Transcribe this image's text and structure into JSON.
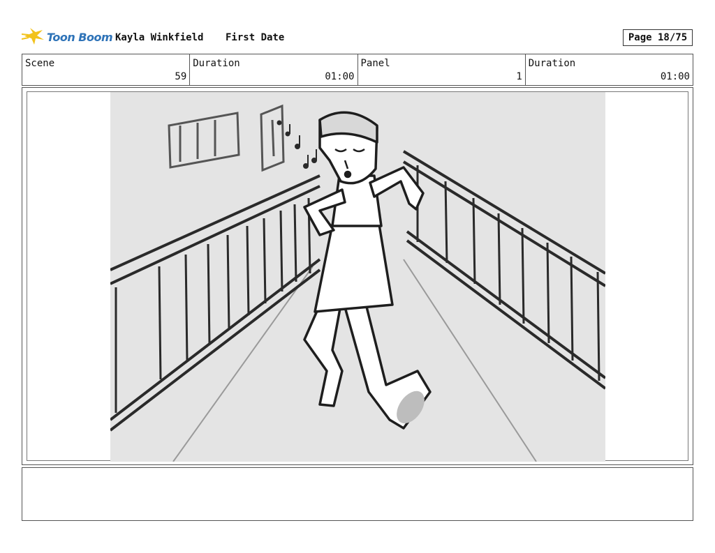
{
  "header": {
    "logo_text": "Toon Boom",
    "author": "Kayla Winkfield",
    "project": "First Date",
    "page": "Page 18/75"
  },
  "info": {
    "scene_label": "Scene",
    "scene_value": "59",
    "duration_label": "Duration",
    "duration_value": "01:00",
    "panel_label": "Panel",
    "panel_value": "1",
    "panel_duration_label": "Duration",
    "panel_duration_value": "01:00"
  },
  "colors": {
    "logo_blue": "#2e73b8",
    "logo_star": "#f2c21b",
    "sketch_bg": "#e4e4e4",
    "ink": "#2a2a2a"
  },
  "notes": ""
}
